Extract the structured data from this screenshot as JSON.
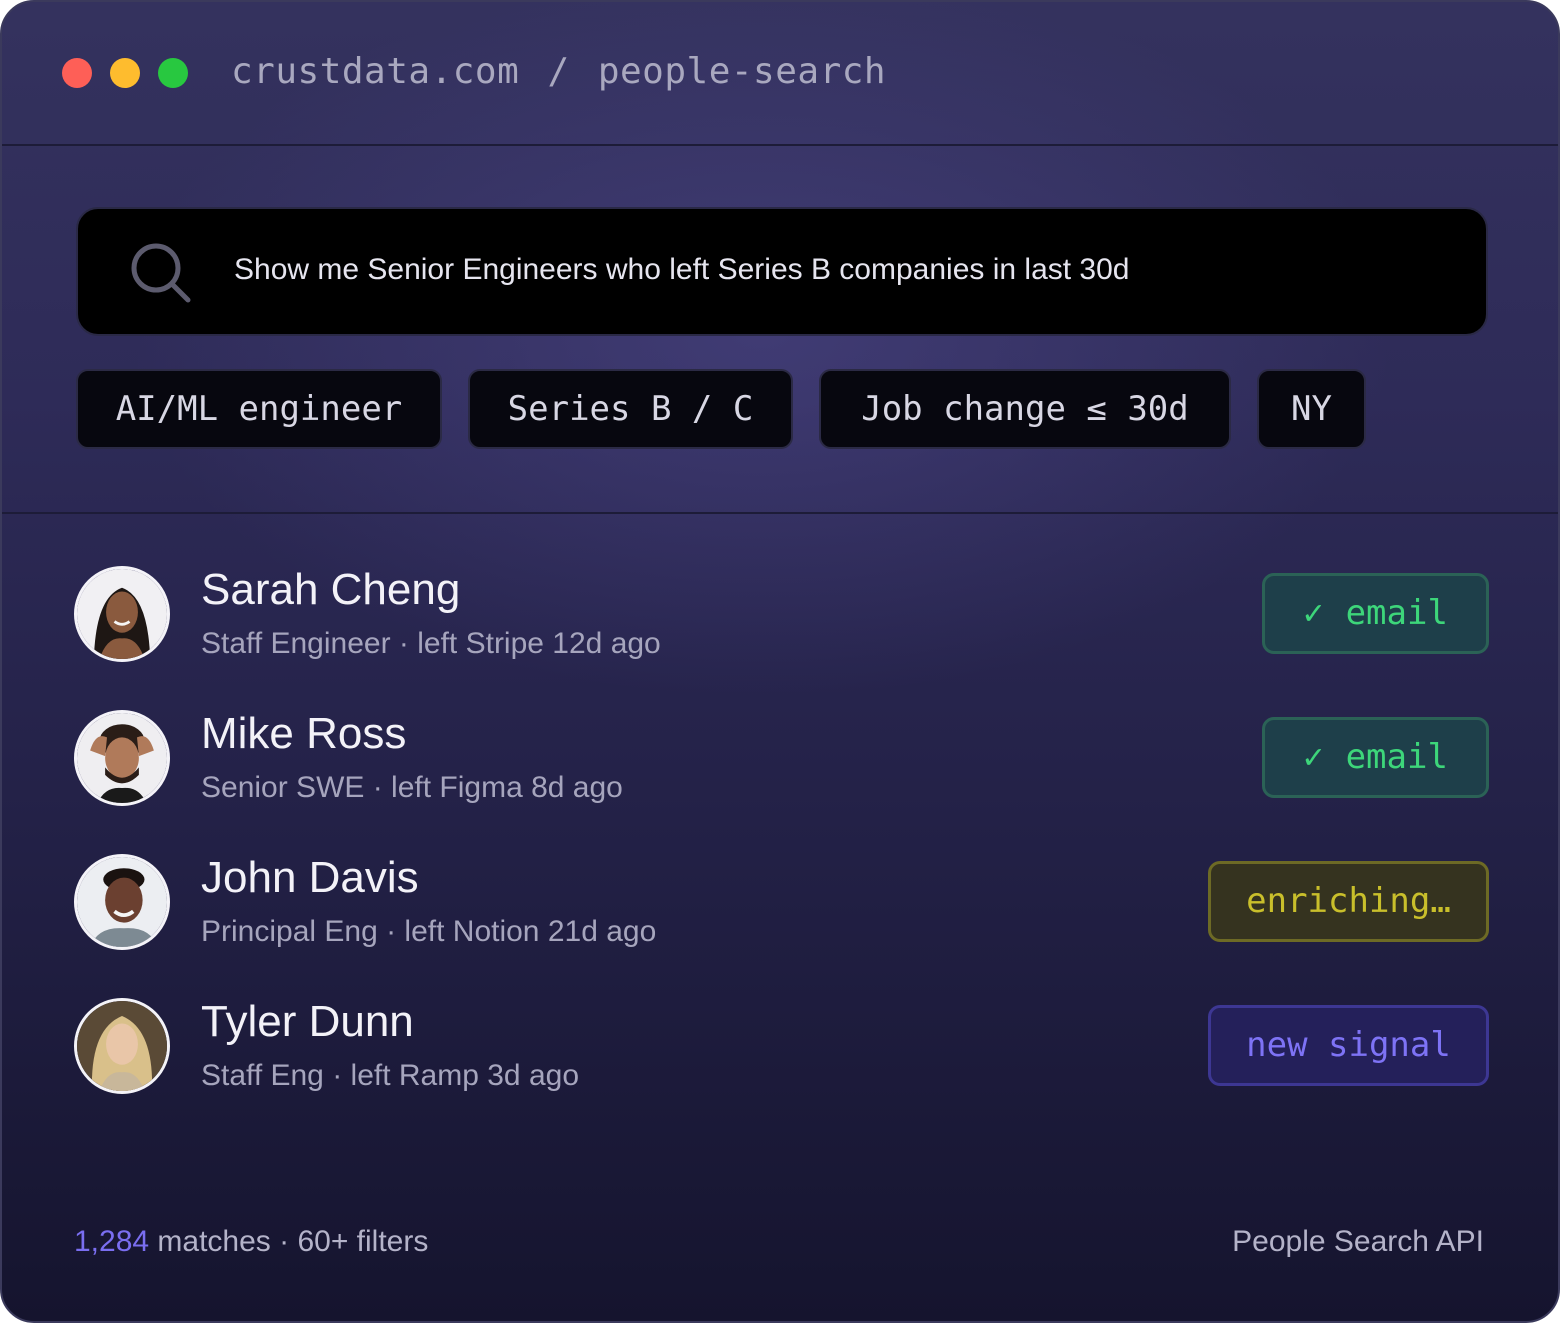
{
  "titlebar": {
    "domain": "crustdata.com",
    "separator": "/",
    "path": "people-search"
  },
  "search": {
    "query": "Show me Senior Engineers who left Series B companies in last 30d",
    "icon": "search-icon"
  },
  "filters": [
    {
      "label": "AI/ML engineer"
    },
    {
      "label": "Series B / C"
    },
    {
      "label": "Job change ≤ 30d"
    },
    {
      "label": "NY"
    }
  ],
  "results": [
    {
      "name": "Sarah Cheng",
      "meta": "Staff Engineer · left Stripe 12d ago",
      "status": "email",
      "check": "✓"
    },
    {
      "name": "Mike Ross",
      "meta": "Senior SWE · left Figma 8d ago",
      "status": "email",
      "check": "✓"
    },
    {
      "name": "John Davis",
      "meta": "Principal Eng · left Notion 21d ago",
      "status": "enriching…"
    },
    {
      "name": "Tyler Dunn",
      "meta": "Staff Eng · left Ramp 3d ago",
      "status": "new signal"
    }
  ],
  "footer": {
    "count": "1,284",
    "summary": " matches · 60+ filters",
    "product": "People Search API"
  },
  "colors": {
    "accent": "#7a6ef0",
    "email_green": "#3dd67a",
    "enriching_yellow": "#c9bf2b",
    "signal_purple": "#7e73f5",
    "traffic_red": "#fe5f57",
    "traffic_yellow": "#febc2e",
    "traffic_green": "#28c840"
  }
}
